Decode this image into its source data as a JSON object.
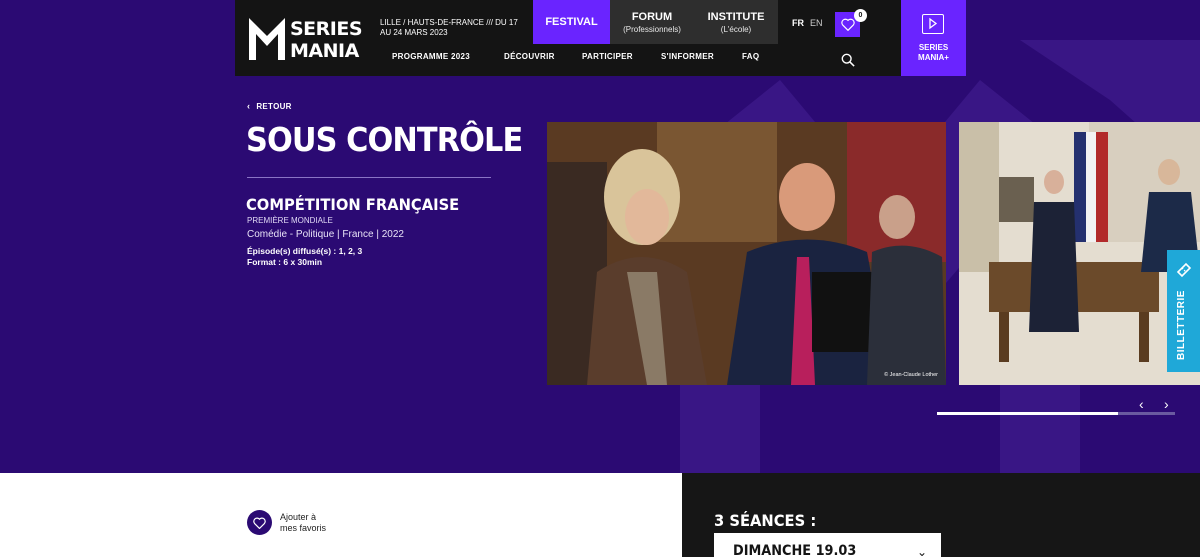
{
  "header": {
    "logo_line1": "SERIES",
    "logo_line2": "MANIA",
    "dates": "LILLE / HAUTS-DE-FRANCE /// DU 17 AU 24 MARS 2023",
    "nav_top": [
      {
        "label": "FESTIVAL",
        "sub": ""
      },
      {
        "label": "FORUM",
        "sub": "(Professionnels)"
      },
      {
        "label": "INSTITUTE",
        "sub": "(L'école)"
      }
    ],
    "lang_fr": "FR",
    "lang_en": "EN",
    "favorites_count": "0",
    "nav_bottom": [
      "PROGRAMME 2023",
      "DÉCOUVRIR",
      "PARTICIPER",
      "S'INFORMER",
      "FAQ"
    ],
    "plus_line1": "SERIES",
    "plus_line2": "MANIA+"
  },
  "show": {
    "back_label": "RETOUR",
    "title": "SOUS CONTRÔLE",
    "competition": "COMPÉTITION FRANÇAISE",
    "premiere": "PREMIÈRE MONDIALE",
    "genre": "Comédie - Politique | France | 2022",
    "episodes": "Épisode(s) diffusé(s) : 1, 2, 3",
    "format": "Format : 6 x 30min"
  },
  "gallery": {
    "credit": "© Jean-Claude Lother",
    "progress_fraction": 0.76
  },
  "billetterie_label": "BILLETTERIE",
  "lower": {
    "fav_line1": "Ajouter à",
    "fav_line2": "mes favoris",
    "seances_title": "3 SÉANCES :",
    "first_date": "DIMANCHE 19.03"
  },
  "colors": {
    "hero_bg": "#2b0a73",
    "accent": "#6a24ff",
    "header_bg": "#141414",
    "billetterie": "#1fa8d8"
  }
}
